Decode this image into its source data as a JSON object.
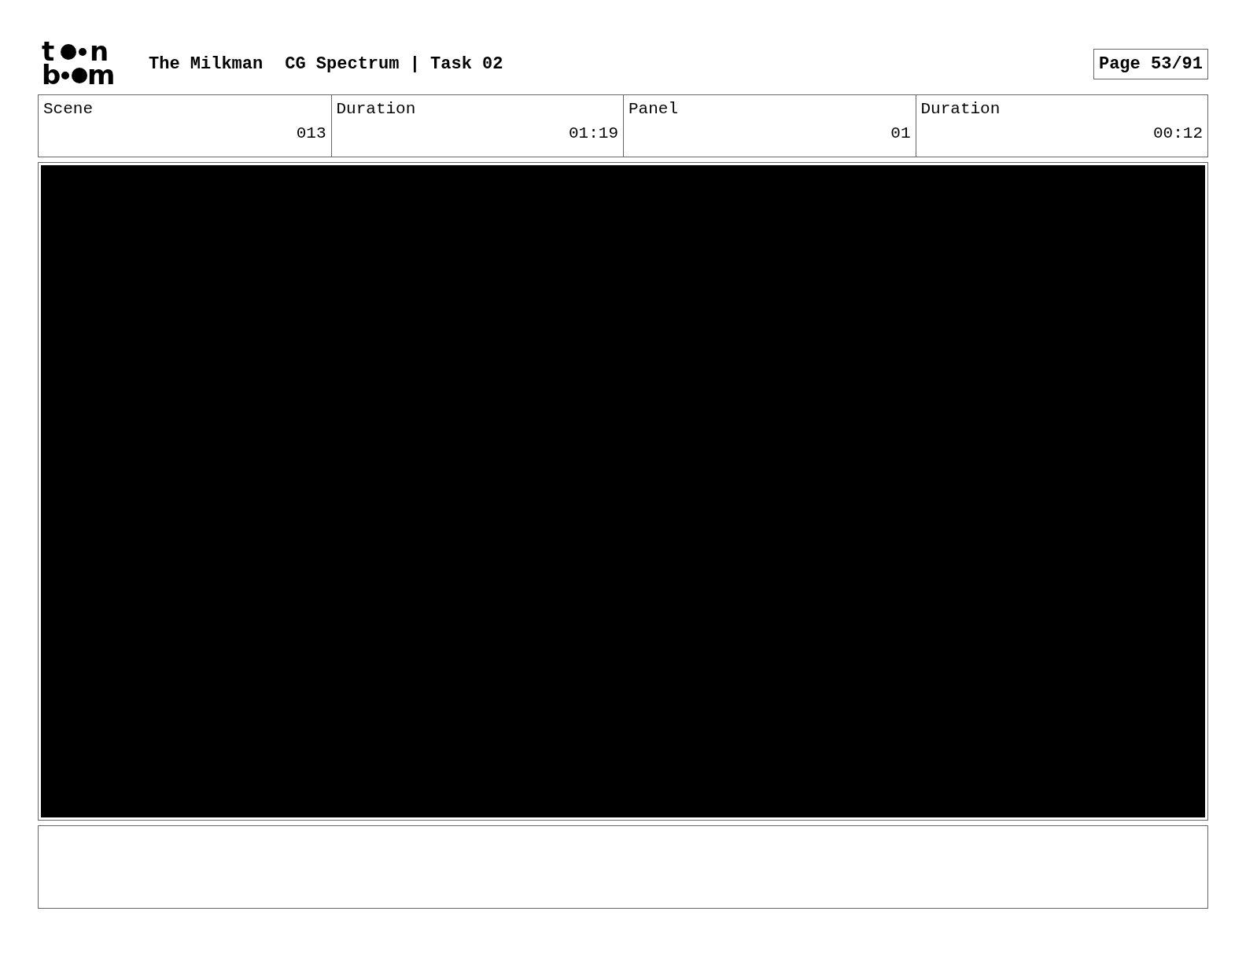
{
  "logo": {
    "letters": [
      "t",
      "n",
      "b",
      "m"
    ]
  },
  "title": "The Milkman",
  "subtitle": "CG Spectrum | Task 02",
  "page": "Page 53/91",
  "table": {
    "columns": [
      "Scene",
      "Duration",
      "Panel",
      "Duration"
    ],
    "rows": [
      [
        "013",
        "01:19",
        "01",
        "00:12"
      ]
    ]
  }
}
